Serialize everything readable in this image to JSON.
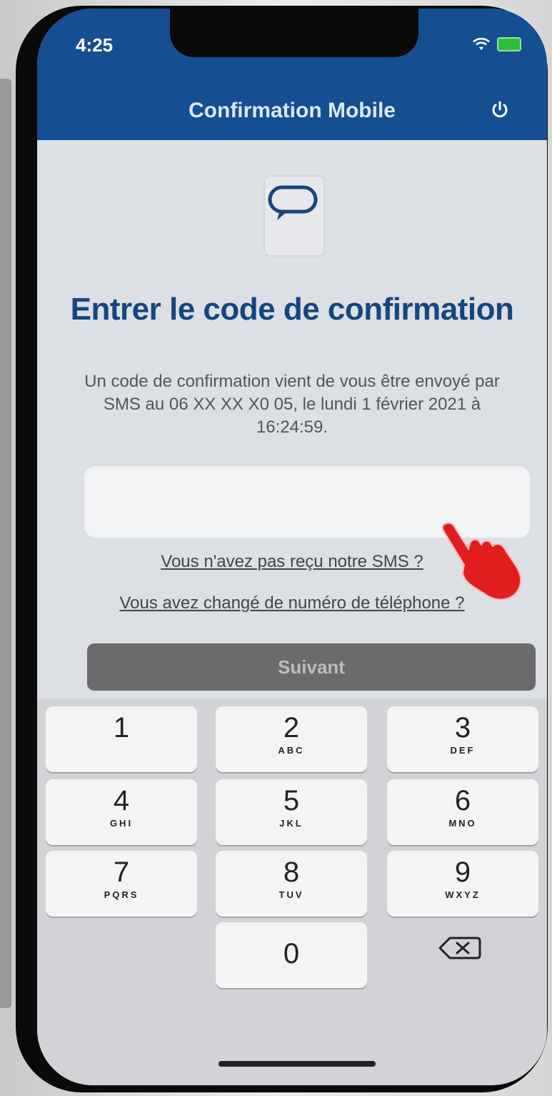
{
  "status_bar": {
    "time": "4:25"
  },
  "header": {
    "title": "Confirmation Mobile"
  },
  "main": {
    "heading": "Entrer le code de confirmation",
    "description": "Un code de confirmation vient de vous être envoyé par SMS au 06 XX XX X0 05, le lundi 1 février 2021 à 16:24:59.",
    "code_value": "",
    "link_no_sms": "Vous n'avez pas reçu notre SMS ?",
    "link_changed_number": "Vous avez changé de numéro de téléphone ?",
    "next_button": "Suivant"
  },
  "keypad": {
    "keys": [
      {
        "num": "1",
        "sub": ""
      },
      {
        "num": "2",
        "sub": "ABC"
      },
      {
        "num": "3",
        "sub": "DEF"
      },
      {
        "num": "4",
        "sub": "GHI"
      },
      {
        "num": "5",
        "sub": "JKL"
      },
      {
        "num": "6",
        "sub": "MNO"
      },
      {
        "num": "7",
        "sub": "PQRS"
      },
      {
        "num": "8",
        "sub": "TUV"
      },
      {
        "num": "9",
        "sub": "WXYZ"
      },
      {
        "num": "0",
        "sub": ""
      }
    ]
  },
  "colors": {
    "header_bg": "#164e92",
    "heading_text": "#16457f",
    "button_bg": "#6b6b6b",
    "pointer_hand": "#e11d1d"
  },
  "icons": [
    "wifi-icon",
    "battery-icon",
    "power-icon",
    "chat-bubble-icon",
    "backspace-icon",
    "pointing-hand-icon"
  ]
}
